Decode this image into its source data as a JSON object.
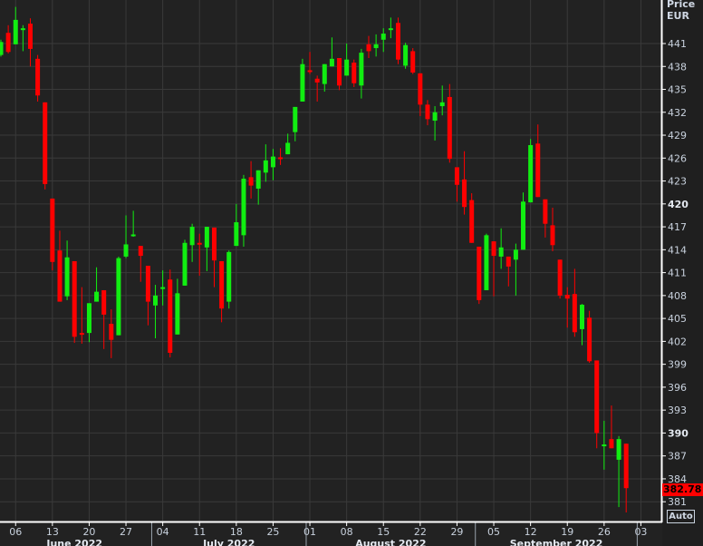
{
  "header": {
    "price_label": "Price",
    "currency": "EUR"
  },
  "last_price_label": "382.78",
  "auto_button": "Auto",
  "colors": {
    "background": "#222222",
    "grid": "#3a3a3a",
    "up": "#11ee11",
    "down": "#ff0000",
    "axis": "#ffffff",
    "text": "#c9d2de"
  },
  "chart_data": {
    "type": "candlestick",
    "title": "",
    "ylabel": "Price EUR",
    "ylim": [
      378.5,
      446.5
    ],
    "y_ticks": [
      441,
      438,
      435,
      432,
      429,
      426,
      423,
      420,
      417,
      414,
      411,
      408,
      405,
      402,
      399,
      396,
      393,
      390,
      387,
      384,
      381
    ],
    "y_ticks_bold": [
      420,
      390
    ],
    "last_price": 382.78,
    "x_ticks": [
      {
        "label": "06",
        "index": 2
      },
      {
        "label": "13",
        "index": 7
      },
      {
        "label": "20",
        "index": 12
      },
      {
        "label": "27",
        "index": 17
      },
      {
        "label": "04",
        "index": 22
      },
      {
        "label": "11",
        "index": 27
      },
      {
        "label": "18",
        "index": 32
      },
      {
        "label": "25",
        "index": 37
      },
      {
        "label": "01",
        "index": 42
      },
      {
        "label": "08",
        "index": 47
      },
      {
        "label": "15",
        "index": 52
      },
      {
        "label": "22",
        "index": 57
      },
      {
        "label": "29",
        "index": 62
      },
      {
        "label": "05",
        "index": 67
      },
      {
        "label": "12",
        "index": 72
      },
      {
        "label": "19",
        "index": 77
      },
      {
        "label": "26",
        "index": 82
      },
      {
        "label": "03",
        "index": 87
      }
    ],
    "months": [
      {
        "label": "June 2022",
        "start": -0.5,
        "end": 20.5
      },
      {
        "label": "July 2022",
        "start": 20.5,
        "end": 41.5
      },
      {
        "label": "August 2022",
        "start": 41.5,
        "end": 64.5
      },
      {
        "label": "September 2022",
        "start": 64.5,
        "end": 86.5
      }
    ],
    "ohlc_fields": [
      "open",
      "high",
      "low",
      "close"
    ],
    "candles": [
      [
        439.5,
        441.5,
        439.3,
        441.2
      ],
      [
        442.4,
        443.4,
        439.7,
        439.9
      ],
      [
        440.9,
        445.8,
        440.9,
        444.1
      ],
      [
        442.9,
        443.4,
        440.0,
        443.0
      ],
      [
        443.6,
        444.3,
        438.0,
        440.3
      ],
      [
        439.0,
        439.5,
        433.4,
        434.2
      ],
      [
        433.3,
        433.3,
        421.9,
        422.6
      ],
      [
        420.7,
        420.7,
        411.3,
        412.4
      ],
      [
        413.9,
        416.5,
        407.2,
        407.2
      ],
      [
        407.9,
        415.2,
        407.4,
        413.0
      ],
      [
        412.5,
        412.5,
        401.8,
        402.6
      ],
      [
        403.1,
        409.1,
        401.7,
        403.0
      ],
      [
        403.1,
        407.0,
        401.9,
        407.0
      ],
      [
        407.2,
        411.7,
        407.2,
        408.5
      ],
      [
        408.7,
        408.7,
        401.0,
        405.5
      ],
      [
        404.3,
        406.2,
        399.8,
        402.2
      ],
      [
        402.8,
        413.1,
        402.8,
        412.9
      ],
      [
        413.1,
        418.5,
        412.9,
        414.7
      ],
      [
        415.9,
        419.1,
        415.7,
        416.0
      ],
      [
        414.5,
        414.5,
        409.8,
        413.2
      ],
      [
        411.9,
        411.9,
        404.1,
        407.2
      ],
      [
        406.7,
        409.4,
        402.4,
        408.0
      ],
      [
        409.0,
        411.3,
        406.7,
        409.1
      ],
      [
        410.1,
        411.4,
        399.9,
        400.5
      ],
      [
        402.9,
        410.2,
        402.9,
        408.3
      ],
      [
        409.3,
        415.3,
        409.3,
        414.9
      ],
      [
        414.6,
        417.4,
        412.4,
        417.0
      ],
      [
        414.9,
        416.1,
        410.6,
        414.8
      ],
      [
        414.3,
        417.0,
        411.2,
        417.0
      ],
      [
        416.9,
        416.9,
        409.1,
        412.6
      ],
      [
        412.5,
        412.5,
        404.5,
        406.3
      ],
      [
        407.2,
        413.9,
        406.3,
        413.7
      ],
      [
        414.5,
        420.0,
        414.5,
        417.6
      ],
      [
        415.9,
        423.8,
        414.4,
        423.3
      ],
      [
        423.5,
        425.6,
        420.7,
        422.4
      ],
      [
        422.0,
        424.4,
        419.9,
        424.4
      ],
      [
        424.1,
        427.8,
        422.9,
        425.7
      ],
      [
        424.8,
        427.2,
        423.1,
        426.2
      ],
      [
        426.1,
        427.3,
        425.1,
        425.9
      ],
      [
        426.5,
        429.2,
        426.5,
        428.0
      ],
      [
        429.4,
        432.7,
        428.2,
        432.7
      ],
      [
        433.4,
        439.0,
        433.4,
        438.3
      ],
      [
        437.5,
        439.9,
        437.0,
        437.3
      ],
      [
        436.4,
        436.8,
        433.4,
        435.9
      ],
      [
        435.7,
        438.3,
        434.7,
        438.3
      ],
      [
        438.0,
        441.8,
        438.0,
        439.0
      ],
      [
        439.1,
        439.1,
        434.9,
        435.5
      ],
      [
        436.8,
        441.0,
        436.8,
        438.9
      ],
      [
        438.5,
        438.9,
        435.3,
        435.8
      ],
      [
        435.5,
        440.3,
        433.8,
        439.8
      ],
      [
        440.9,
        442.0,
        439.1,
        440.0
      ],
      [
        440.4,
        442.2,
        439.3,
        440.9
      ],
      [
        441.5,
        443.0,
        439.9,
        442.3
      ],
      [
        442.9,
        444.4,
        441.7,
        443.0
      ],
      [
        443.7,
        444.4,
        438.3,
        438.9
      ],
      [
        438.1,
        441.1,
        437.7,
        440.8
      ],
      [
        440.0,
        440.4,
        437.0,
        437.2
      ],
      [
        437.1,
        437.1,
        431.5,
        433.0
      ],
      [
        433.0,
        433.6,
        430.3,
        431.1
      ],
      [
        430.9,
        432.8,
        428.3,
        432.0
      ],
      [
        432.8,
        435.5,
        431.6,
        433.3
      ],
      [
        434.0,
        435.7,
        425.4,
        425.9
      ],
      [
        424.8,
        424.8,
        420.3,
        422.5
      ],
      [
        423.2,
        426.9,
        418.6,
        419.6
      ],
      [
        420.5,
        421.4,
        414.9,
        414.9
      ],
      [
        414.4,
        414.4,
        406.9,
        407.4
      ],
      [
        408.7,
        416.1,
        408.7,
        415.9
      ],
      [
        415.1,
        415.1,
        407.9,
        413.2
      ],
      [
        413.1,
        416.8,
        411.5,
        414.3
      ],
      [
        413.1,
        413.1,
        409.2,
        411.8
      ],
      [
        412.7,
        414.8,
        408.0,
        414.0
      ],
      [
        414.0,
        421.5,
        414.0,
        420.3
      ],
      [
        420.2,
        428.5,
        420.2,
        427.7
      ],
      [
        427.9,
        430.4,
        420.9,
        420.9
      ],
      [
        420.6,
        420.6,
        415.6,
        417.4
      ],
      [
        417.2,
        419.5,
        413.8,
        414.6
      ],
      [
        412.7,
        412.7,
        407.6,
        408.0
      ],
      [
        408.1,
        409.1,
        403.8,
        407.6
      ],
      [
        408.2,
        411.5,
        402.6,
        403.2
      ],
      [
        403.6,
        406.9,
        401.5,
        406.8
      ],
      [
        405.1,
        406.0,
        399.2,
        399.4
      ],
      [
        399.5,
        399.5,
        388.0,
        390.0
      ],
      [
        388.4,
        391.6,
        385.2,
        388.5
      ],
      [
        389.2,
        393.6,
        388.0,
        388.0
      ],
      [
        386.5,
        389.6,
        380.3,
        389.2
      ],
      [
        388.6,
        388.6,
        379.6,
        382.78
      ]
    ]
  }
}
